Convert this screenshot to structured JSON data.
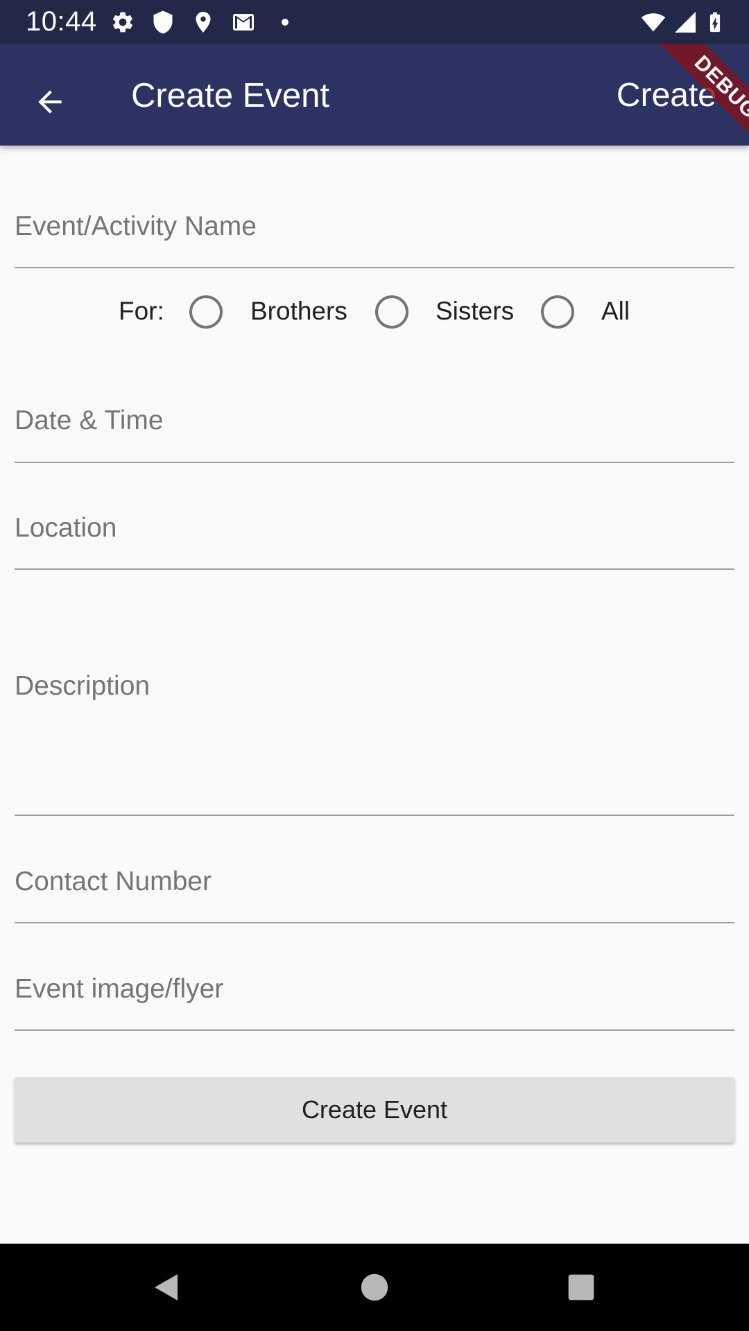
{
  "status_bar": {
    "time": "10:44",
    "icons": [
      "gear-icon",
      "shield-icon",
      "location-pin-icon",
      "gmail-icon",
      "notification-dot",
      "wifi-icon",
      "cell-signal-icon",
      "battery-icon"
    ]
  },
  "app_bar": {
    "back_icon": "arrow-back-icon",
    "title": "Create Event",
    "action_label": "Create",
    "background": "#2c3262"
  },
  "debug_banner": "DEBUG",
  "form": {
    "event_name": {
      "placeholder": "Event/Activity Name",
      "value": ""
    },
    "audience": {
      "label": "For:",
      "options": [
        {
          "label": "Brothers",
          "selected": false
        },
        {
          "label": "Sisters",
          "selected": false
        },
        {
          "label": "All",
          "selected": false
        }
      ]
    },
    "date_time": {
      "placeholder": "Date & Time",
      "value": ""
    },
    "location": {
      "placeholder": "Location",
      "value": ""
    },
    "description": {
      "placeholder": "Description",
      "value": ""
    },
    "contact_number": {
      "placeholder": "Contact Number",
      "value": ""
    },
    "event_image": {
      "placeholder": "Event image/flyer",
      "value": ""
    },
    "submit_label": "Create Event"
  },
  "nav_bar": {
    "buttons": [
      "back-triangle-icon",
      "home-circle-icon",
      "recents-square-icon"
    ]
  }
}
